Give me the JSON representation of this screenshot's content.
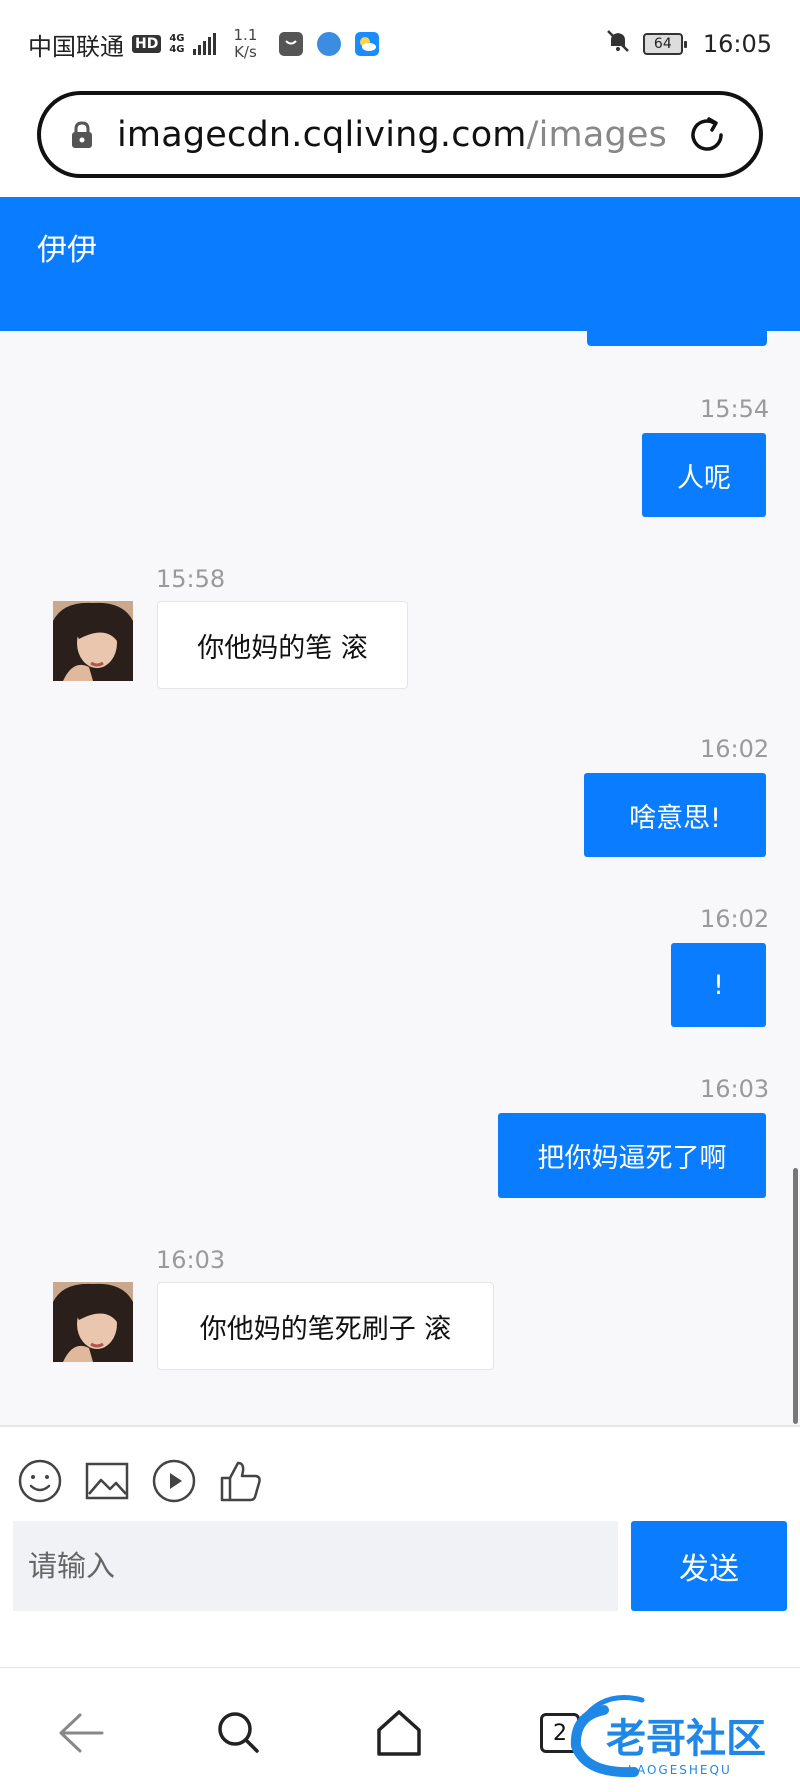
{
  "status_bar": {
    "carrier": "中国联通",
    "hd": "HD",
    "network": "4G",
    "network_sub": "4G",
    "speed_value": "1.1",
    "speed_unit": "K/s",
    "battery": "64",
    "time": "16:05"
  },
  "browser": {
    "url_domain": "imagecdn.cqliving.com",
    "url_path": "/images/ap"
  },
  "chat": {
    "title": "伊伊",
    "messages": [
      {
        "direction": "out",
        "time": "15:54",
        "text": "人呢"
      },
      {
        "direction": "in",
        "time": "15:58",
        "text": "你他妈的笔 滚"
      },
      {
        "direction": "out",
        "time": "16:02",
        "text": "啥意思!"
      },
      {
        "direction": "out",
        "time": "16:02",
        "text": "!"
      },
      {
        "direction": "out",
        "time": "16:03",
        "text": "把你妈逼死了啊"
      },
      {
        "direction": "in",
        "time": "16:03",
        "text": "你他妈的笔死刷子 滚"
      }
    ]
  },
  "composer": {
    "placeholder": "请输入",
    "send_label": "发送",
    "tools": [
      "emoji-icon",
      "image-icon",
      "video-icon",
      "thumbs-up-icon"
    ]
  },
  "nav": {
    "tab_count": "2"
  },
  "watermark": {
    "title": "老哥社区",
    "subtitle": "LAOGESHEQU"
  },
  "colors": {
    "accent": "#0a7cff",
    "chat_bg": "#f8f8fa",
    "input_bg": "#f1f2f5"
  }
}
